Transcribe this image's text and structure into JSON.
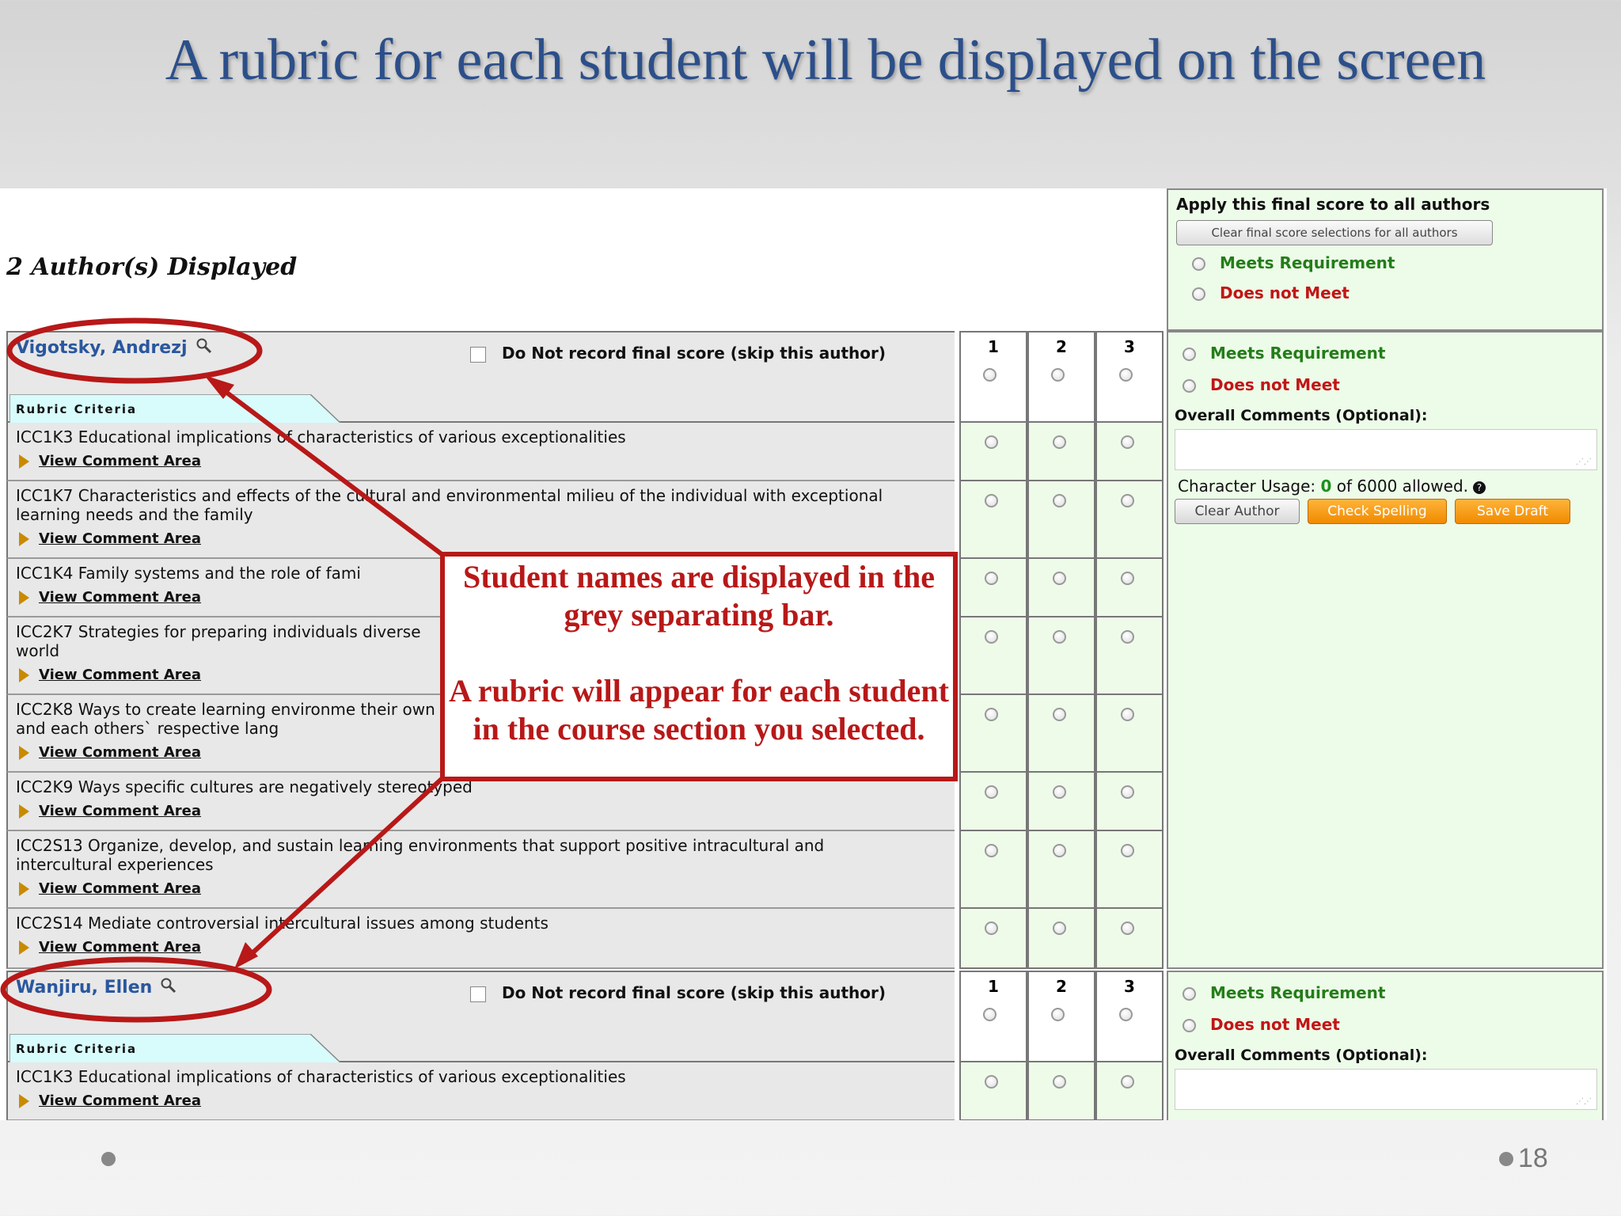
{
  "slide": {
    "title": "A rubric for each student will be displayed on the screen",
    "page_number": "18"
  },
  "rubric_page": {
    "authors_displayed": "2 Author(s) Displayed",
    "apply_panel": {
      "title": "Apply this final score to all authors",
      "clear_button": "Clear final score selections for all authors",
      "meets": "Meets Requirement",
      "does_not_meet": "Does not Meet"
    },
    "score_columns": [
      "1",
      "2",
      "3"
    ],
    "tab_label": "Rubric Criteria",
    "skip_label": "Do Not record final score (skip this author)",
    "view_comment_label": "View Comment Area",
    "comments_label": "Overall Comments (Optional):",
    "usage": {
      "prefix": "Character Usage: ",
      "count": "0",
      "suffix": " of 6000 allowed."
    },
    "buttons": {
      "clear_author": "Clear Author",
      "check_spelling": "Check Spelling",
      "save_draft": "Save Draft"
    },
    "authors": [
      {
        "name": "Vigotsky, Andrezj",
        "criteria": [
          "ICC1K3 Educational implications of characteristics of various exceptionalities",
          "ICC1K7 Characteristics and effects of the cultural and environmental milieu of the individual with exceptional learning needs and the family",
          "ICC1K4 Family systems and the role of fami",
          "ICC2K7 Strategies for preparing individuals diverse world",
          "ICC2K8 Ways to create learning environme their own and each others` respective lang",
          "ICC2K9 Ways specific cultures are negatively stereotyped",
          "ICC2S13 Organize, develop, and sustain learning environments that support positive intracultural and intercultural experiences",
          "ICC2S14 Mediate controversial intercultural issues among students"
        ]
      },
      {
        "name": "Wanjiru, Ellen",
        "criteria": [
          "ICC1K3 Educational implications of characteristics of various exceptionalities"
        ]
      }
    ]
  },
  "callout": {
    "line1": "Student names are displayed in the grey separating bar.",
    "line2": "A rubric will appear for each student in the course section you selected."
  },
  "colors": {
    "title": "#2c4f8a",
    "annotation": "#b81818",
    "meets": "#237d18",
    "not_meet": "#c21515",
    "panel": "#edfbe9"
  }
}
